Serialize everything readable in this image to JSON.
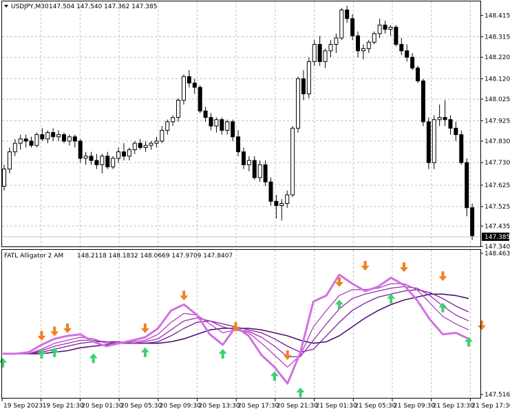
{
  "window": {
    "symbol_title": "USDJPY,M30",
    "ohlc_values": "147.504 147.540 147.362 147.385"
  },
  "indicator": {
    "title": "FATL Alligator 2 AM",
    "values": "148.2118 148.1832 148.0669 147.9709 147.8407"
  },
  "colors": {
    "background": "#ffffff",
    "candle_bull_fill": "#ffffff",
    "candle_bear_fill": "#000000",
    "fatl_main": "#d070e0",
    "alligator_lines": [
      "#d070e0",
      "#b040c0",
      "#9c2bb0",
      "#7a1a9a",
      "#4a1070"
    ],
    "arrow_up": "#3cd070",
    "arrow_down": "#f08020",
    "price_label_bg": "#000000",
    "price_label_text": "#ffffff"
  },
  "chart_data": [
    {
      "type": "candlestick",
      "title": "USDJPY,M30",
      "ylim": [
        147.34,
        148.48
      ],
      "y_ticks": [
        "148.415",
        "148.315",
        "148.220",
        "148.120",
        "148.025",
        "147.925",
        "147.830",
        "147.730",
        "147.625",
        "147.525",
        "147.435",
        "147.340"
      ],
      "current_price": "147.385",
      "candles": [
        [
          147.62,
          147.72,
          147.6,
          147.7
        ],
        [
          147.7,
          147.8,
          147.68,
          147.78
        ],
        [
          147.78,
          147.84,
          147.76,
          147.82
        ],
        [
          147.82,
          147.86,
          147.79,
          147.84
        ],
        [
          147.84,
          147.86,
          147.8,
          147.83
        ],
        [
          147.83,
          147.85,
          147.8,
          147.81
        ],
        [
          147.81,
          147.87,
          147.8,
          147.86
        ],
        [
          147.86,
          147.89,
          147.83,
          147.84
        ],
        [
          147.84,
          147.88,
          147.82,
          147.87
        ],
        [
          147.87,
          147.89,
          147.83,
          147.85
        ],
        [
          147.85,
          147.88,
          147.83,
          147.86
        ],
        [
          147.86,
          147.87,
          147.82,
          147.83
        ],
        [
          147.83,
          147.86,
          147.81,
          147.85
        ],
        [
          147.85,
          147.86,
          147.8,
          147.83
        ],
        [
          147.83,
          147.84,
          147.73,
          147.75
        ],
        [
          147.75,
          147.78,
          147.72,
          147.76
        ],
        [
          147.76,
          147.78,
          147.72,
          147.74
        ],
        [
          147.74,
          147.77,
          147.7,
          147.72
        ],
        [
          147.72,
          147.77,
          147.68,
          147.76
        ],
        [
          147.76,
          147.78,
          147.7,
          147.71
        ],
        [
          147.71,
          147.76,
          147.7,
          147.75
        ],
        [
          147.75,
          147.8,
          147.73,
          147.78
        ],
        [
          147.78,
          147.82,
          147.74,
          147.76
        ],
        [
          147.76,
          147.8,
          147.74,
          147.79
        ],
        [
          147.79,
          147.83,
          147.77,
          147.82
        ],
        [
          147.82,
          147.84,
          147.79,
          147.8
        ],
        [
          147.8,
          147.83,
          147.78,
          147.81
        ],
        [
          147.81,
          147.83,
          147.79,
          147.82
        ],
        [
          147.82,
          147.85,
          147.8,
          147.83
        ],
        [
          147.83,
          147.9,
          147.82,
          147.88
        ],
        [
          147.88,
          147.93,
          147.86,
          147.92
        ],
        [
          147.92,
          147.95,
          147.9,
          147.94
        ],
        [
          147.94,
          148.03,
          147.92,
          148.02
        ],
        [
          148.02,
          148.14,
          148.0,
          148.13
        ],
        [
          148.13,
          148.16,
          148.08,
          148.1
        ],
        [
          148.1,
          148.12,
          148.05,
          148.08
        ],
        [
          148.08,
          148.09,
          147.96,
          147.97
        ],
        [
          147.97,
          147.99,
          147.92,
          147.94
        ],
        [
          147.94,
          147.96,
          147.88,
          147.9
        ],
        [
          147.9,
          147.94,
          147.87,
          147.93
        ],
        [
          147.93,
          147.94,
          147.86,
          147.88
        ],
        [
          147.88,
          147.93,
          147.86,
          147.92
        ],
        [
          147.92,
          147.93,
          147.83,
          147.85
        ],
        [
          147.85,
          147.88,
          147.76,
          147.78
        ],
        [
          147.78,
          147.8,
          147.7,
          147.72
        ],
        [
          147.72,
          147.76,
          147.69,
          147.74
        ],
        [
          147.74,
          147.76,
          147.65,
          147.66
        ],
        [
          147.66,
          147.74,
          147.64,
          147.72
        ],
        [
          147.72,
          147.74,
          147.62,
          147.64
        ],
        [
          147.64,
          147.66,
          147.53,
          147.55
        ],
        [
          147.55,
          147.58,
          147.47,
          147.53
        ],
        [
          147.53,
          147.56,
          147.46,
          147.54
        ],
        [
          147.54,
          147.6,
          147.52,
          147.58
        ],
        [
          147.58,
          147.9,
          147.57,
          147.89
        ],
        [
          147.89,
          148.13,
          147.87,
          148.12
        ],
        [
          148.12,
          148.16,
          148.02,
          148.05
        ],
        [
          148.05,
          148.22,
          148.03,
          148.2
        ],
        [
          148.2,
          148.3,
          148.18,
          148.28
        ],
        [
          148.28,
          148.32,
          148.18,
          148.2
        ],
        [
          148.2,
          148.26,
          148.17,
          148.25
        ],
        [
          148.25,
          148.3,
          148.22,
          148.28
        ],
        [
          148.28,
          148.33,
          148.24,
          148.31
        ],
        [
          148.31,
          148.45,
          148.3,
          148.44
        ],
        [
          148.44,
          148.46,
          148.38,
          148.4
        ],
        [
          148.4,
          148.42,
          148.3,
          148.32
        ],
        [
          148.32,
          148.34,
          148.22,
          148.25
        ],
        [
          148.25,
          148.28,
          148.21,
          148.26
        ],
        [
          148.26,
          148.3,
          148.24,
          148.29
        ],
        [
          148.29,
          148.34,
          148.28,
          148.33
        ],
        [
          148.33,
          148.4,
          148.31,
          148.37
        ],
        [
          148.37,
          148.39,
          148.33,
          148.35
        ],
        [
          148.35,
          148.37,
          148.32,
          148.36
        ],
        [
          148.36,
          148.37,
          148.27,
          148.28
        ],
        [
          148.28,
          148.31,
          148.23,
          148.25
        ],
        [
          148.25,
          148.28,
          148.2,
          148.22
        ],
        [
          148.22,
          148.24,
          148.16,
          148.17
        ],
        [
          148.17,
          148.18,
          148.1,
          148.11
        ],
        [
          148.11,
          148.12,
          147.9,
          147.92
        ],
        [
          147.92,
          147.94,
          147.7,
          147.73
        ],
        [
          147.73,
          147.95,
          147.7,
          147.93
        ],
        [
          147.93,
          148.0,
          147.9,
          147.94
        ],
        [
          147.94,
          148.02,
          147.9,
          147.93
        ],
        [
          147.93,
          147.95,
          147.86,
          147.89
        ],
        [
          147.89,
          147.92,
          147.83,
          147.86
        ],
        [
          147.86,
          147.88,
          147.72,
          147.73
        ],
        [
          147.73,
          147.75,
          147.48,
          147.52
        ],
        [
          147.52,
          147.54,
          147.37,
          147.39
        ]
      ]
    },
    {
      "type": "line",
      "title": "FATL Alligator 2 AM",
      "ylim": [
        147.5168,
        148.4637
      ],
      "y_ticks": [
        "148.4637",
        "147.5168"
      ],
      "x_labels": [
        "19 Sep 2023",
        "19 Sep 21:30",
        "20 Sep 01:30",
        "20 Sep 05:30",
        "20 Sep 09:30",
        "20 Sep 13:30",
        "20 Sep 17:30",
        "20 Sep 21:30",
        "21 Sep 01:30",
        "21 Sep 05:30",
        "21 Sep 09:30",
        "21 Sep 13:30",
        "21 Sep 17:30"
      ],
      "series": [
        {
          "values": [
            147.79,
            147.79,
            147.8,
            147.85,
            147.89,
            147.91,
            147.92,
            147.87,
            147.84,
            147.86,
            147.88,
            147.9,
            147.96,
            148.08,
            148.12,
            148.05,
            147.92,
            147.85,
            147.97,
            147.91,
            147.78,
            147.7,
            147.59,
            147.8,
            148.14,
            148.18,
            148.32,
            148.26,
            148.21,
            148.24,
            148.3,
            148.25,
            148.15,
            148.02,
            147.92,
            147.93,
            147.89
          ]
        },
        {
          "values": [
            147.79,
            147.79,
            147.79,
            147.82,
            147.86,
            147.88,
            147.9,
            147.89,
            147.86,
            147.86,
            147.87,
            147.88,
            147.92,
            148.0,
            148.06,
            148.05,
            147.99,
            147.93,
            147.95,
            147.93,
            147.86,
            147.78,
            147.7,
            147.78,
            147.97,
            148.08,
            148.18,
            148.22,
            148.22,
            148.23,
            148.26,
            148.26,
            148.22,
            148.13,
            148.04,
            147.99,
            147.95
          ]
        },
        {
          "values": [
            147.79,
            147.79,
            147.79,
            147.81,
            147.84,
            147.86,
            147.88,
            147.88,
            147.87,
            147.86,
            147.86,
            147.87,
            147.89,
            147.95,
            148.01,
            148.03,
            148.01,
            147.97,
            147.95,
            147.94,
            147.9,
            147.84,
            147.77,
            147.77,
            147.88,
            147.99,
            148.09,
            148.16,
            148.19,
            148.21,
            148.23,
            148.24,
            148.23,
            148.18,
            148.11,
            148.05,
            148.01
          ]
        },
        {
          "values": [
            147.79,
            147.79,
            147.79,
            147.8,
            147.82,
            147.84,
            147.86,
            147.87,
            147.87,
            147.87,
            147.86,
            147.86,
            147.87,
            147.91,
            147.96,
            148.0,
            148.01,
            147.99,
            147.97,
            147.95,
            147.93,
            147.89,
            147.84,
            147.8,
            147.82,
            147.91,
            148.0,
            148.08,
            148.13,
            148.17,
            148.19,
            148.21,
            148.22,
            148.2,
            148.16,
            148.11,
            148.07
          ]
        },
        {
          "values": [
            147.79,
            147.79,
            147.79,
            147.79,
            147.8,
            147.81,
            147.83,
            147.84,
            147.85,
            147.86,
            147.86,
            147.86,
            147.86,
            147.87,
            147.89,
            147.92,
            147.95,
            147.96,
            147.96,
            147.96,
            147.95,
            147.93,
            147.91,
            147.88,
            147.86,
            147.87,
            147.91,
            147.97,
            148.03,
            148.08,
            148.12,
            148.15,
            148.17,
            148.19,
            148.19,
            148.18,
            148.16
          ]
        }
      ],
      "arrows_up": [
        [
          0,
          147.79
        ],
        [
          3,
          147.85
        ],
        [
          4,
          147.86
        ],
        [
          7,
          147.82
        ],
        [
          11,
          147.86
        ],
        [
          17,
          147.85
        ],
        [
          21,
          147.7
        ],
        [
          23,
          147.59
        ],
        [
          26,
          148.18
        ],
        [
          30,
          148.22
        ],
        [
          34,
          148.16
        ],
        [
          36,
          147.93
        ]
      ],
      "arrows_down": [
        [
          3,
          147.85
        ],
        [
          4,
          147.88
        ],
        [
          5,
          147.9
        ],
        [
          11,
          147.9
        ],
        [
          14,
          148.12
        ],
        [
          18,
          147.91
        ],
        [
          22,
          147.72
        ],
        [
          26,
          148.21
        ],
        [
          28,
          148.32
        ],
        [
          31,
          148.31
        ],
        [
          34,
          148.25
        ],
        [
          37,
          147.92
        ]
      ]
    }
  ]
}
